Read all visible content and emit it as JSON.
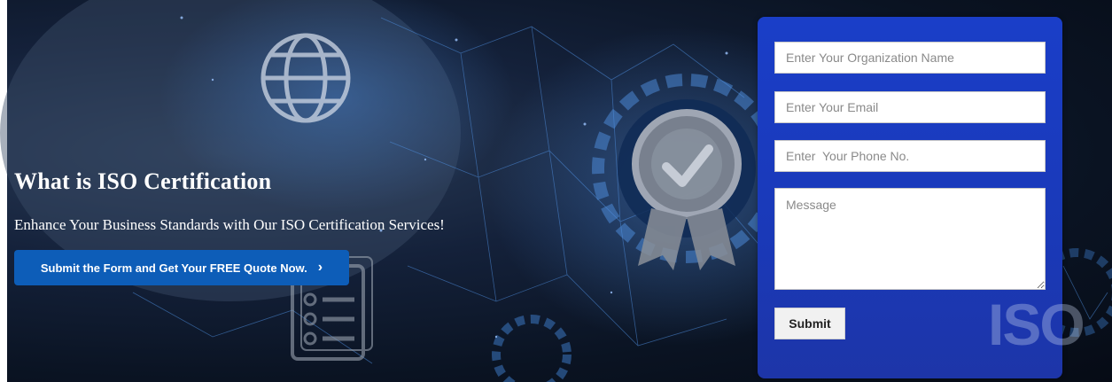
{
  "hero": {
    "heading": "What is ISO Certification",
    "subheading": "Enhance Your Business Standards with Our ISO Certification Services!",
    "cta_label": "Submit the Form and Get Your FREE Quote Now.",
    "cta_icon": "chevron-right-icon",
    "watermark_text": "ISO"
  },
  "form": {
    "organization_placeholder": "Enter Your Organization Name",
    "email_placeholder": "Enter Your Email",
    "phone_placeholder": "Enter  Your Phone No.",
    "message_placeholder": "Message",
    "submit_label": "Submit"
  },
  "colors": {
    "cta_background": "#0d5db8",
    "form_panel": "#1a3ec8",
    "background_dark": "#0a1322"
  }
}
